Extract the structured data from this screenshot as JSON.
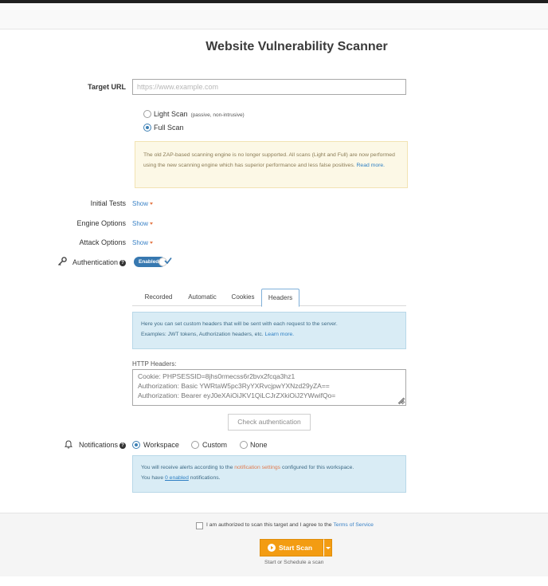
{
  "page": {
    "title": "Website Vulnerability Scanner"
  },
  "target": {
    "label": "Target URL",
    "placeholder": "https://www.example.com",
    "value": ""
  },
  "scan_type": {
    "options": [
      {
        "label": "Light Scan",
        "note": "(passive, non-intrusive)",
        "selected": false
      },
      {
        "label": "Full Scan",
        "note": "",
        "selected": true
      }
    ]
  },
  "warning": {
    "text": "The old ZAP-based scanning engine is no longer supported. All scans (Light and Full) are now performed using the new scanning engine which has superior performance and less false positives.",
    "link": "Read more."
  },
  "options": {
    "initial_tests": {
      "label": "Initial Tests",
      "toggle": "Show"
    },
    "engine_options": {
      "label": "Engine Options",
      "toggle": "Show"
    },
    "attack_options": {
      "label": "Attack Options",
      "toggle": "Show"
    }
  },
  "authentication": {
    "label": "Authentication",
    "help": "?",
    "toggle_label": "Enabled",
    "enabled": true,
    "tabs": [
      "Recorded",
      "Automatic",
      "Cookies",
      "Headers"
    ],
    "active_tab": "Headers",
    "info_line1": "Here you can set custom headers that will be sent with each request to the server.",
    "info_line2": "Examples: JWT tokens, Authorization headers, etc.",
    "info_link": "Learn more.",
    "headers_label": "HTTP Headers:",
    "headers_placeholder": "Cookie: PHPSESSID=8jhs0rmecss6r2bvx2fcqa3hz1\nAuthorization: Basic YWRtaW5pc3RyYXRvcjpwYXNzd29yZA==\nAuthorization: Bearer eyJ0eXAiOiJKV1QiLCJrZXkiOiJ2YWwifQo=",
    "check_button": "Check authentication"
  },
  "notifications": {
    "label": "Notifications",
    "help": "?",
    "options": [
      {
        "label": "Workspace",
        "selected": true
      },
      {
        "label": "Custom",
        "selected": false
      },
      {
        "label": "None",
        "selected": false
      }
    ],
    "info_prefix": "You will receive alerts according to the",
    "info_link": "notification settings",
    "info_suffix": "configured for this workspace.",
    "count_prefix": "You have",
    "count_link": "0 enabled",
    "count_suffix": "notifications."
  },
  "footer": {
    "agree_text": "I am authorized to scan this target and I agree to the",
    "terms_link": "Terms of Service",
    "agreed": false,
    "start_button": "Start Scan",
    "schedule_hint": "Start or Schedule a scan"
  },
  "colors": {
    "accent_blue": "#3778b0",
    "start_orange": "#f39c12",
    "warning_bg": "#fcf8e6",
    "info_bg": "#d9ecf5"
  }
}
